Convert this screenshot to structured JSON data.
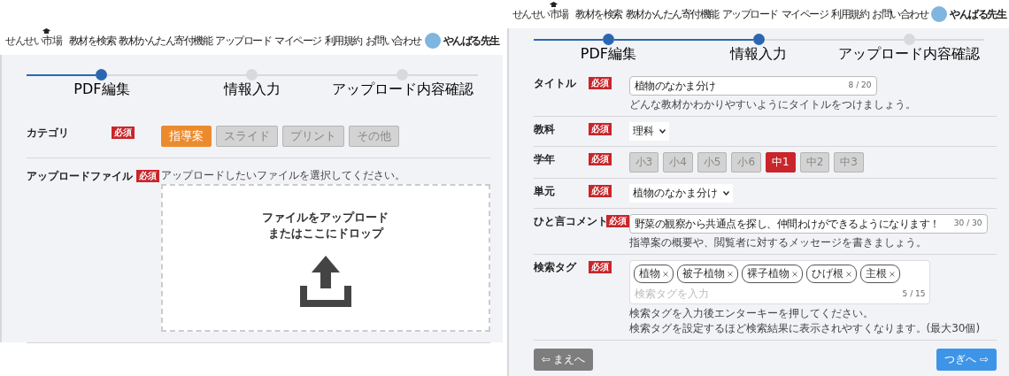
{
  "screens": [
    {
      "header": {
        "logo": "せんせい市場",
        "nav": [
          "教材を検索",
          "教材かんたん寄付機能",
          "アップロード",
          "マイページ",
          "利用規約",
          "お問い合わせ"
        ],
        "user": "やんばる先生"
      },
      "steps": [
        {
          "label": "PDF編集",
          "reached": true
        },
        {
          "label": "情報入力",
          "reached": false
        },
        {
          "label": "アップロード内容確認",
          "reached": false
        }
      ],
      "rows": [
        {
          "kind": "categories",
          "label": "カテゴリ",
          "badge": "必須",
          "options": [
            {
              "label": "指導案",
              "selected": true
            },
            {
              "label": "スライド",
              "selected": false
            },
            {
              "label": "プリント",
              "selected": false
            },
            {
              "label": "その他",
              "selected": false
            }
          ]
        },
        {
          "kind": "upload",
          "label": "アップロードファイル",
          "badge": "必須",
          "hint": "アップロードしたいファイルを選択してください。",
          "drop_lines": [
            "ファイルをアップロード",
            "またはここにドロップ"
          ]
        }
      ]
    },
    {
      "header": {
        "logo": "せんせい市場",
        "nav": [
          "教材を検索",
          "教材かんたん寄付機能",
          "アップロード",
          "マイページ",
          "利用規約",
          "お問い合わせ"
        ],
        "user": "やんばる先生"
      },
      "steps": [
        {
          "label": "PDF編集",
          "reached": true
        },
        {
          "label": "情報入力",
          "reached": true
        },
        {
          "label": "アップロード内容確認",
          "reached": false
        }
      ],
      "rows": [
        {
          "kind": "text",
          "label": "タイトル",
          "badge": "必須",
          "value": "植物のなかま分け",
          "counter": "8 / 20",
          "hints": [
            "どんな教材かわかりやすいようにタイトルをつけましょう。"
          ]
        },
        {
          "kind": "select",
          "label": "教科",
          "badge": "必須",
          "value": "理科"
        },
        {
          "kind": "grades",
          "label": "学年",
          "badge": "必須",
          "options": [
            {
              "label": "小3",
              "selected": false
            },
            {
              "label": "小4",
              "selected": false
            },
            {
              "label": "小5",
              "selected": false
            },
            {
              "label": "小6",
              "selected": false
            },
            {
              "label": "中1",
              "selected": true
            },
            {
              "label": "中2",
              "selected": false
            },
            {
              "label": "中3",
              "selected": false
            }
          ]
        },
        {
          "kind": "select",
          "label": "単元",
          "badge": "必須",
          "value": "植物のなかま分け"
        },
        {
          "kind": "text",
          "label": "ひと言コメント",
          "badge": "必須",
          "value": "野菜の観察から共通点を探し、仲間わけができるようになります！",
          "counter": "30 / 30",
          "hints": [
            "指導案の概要や、閲覧者に対するメッセージを書きましょう。"
          ]
        },
        {
          "kind": "tags",
          "label": "検索タグ",
          "badge": "必須",
          "tags": [
            "植物",
            "被子植物",
            "裸子植物",
            "ひげ根",
            "主根"
          ],
          "placeholder": "検索タグを入力",
          "counter": "5 / 15",
          "hints": [
            "検索タグを入力後エンターキーを押してください。",
            "検索タグを設定するほど検索結果に表示されやすくなります。(最大30個)"
          ]
        }
      ],
      "buttons": [
        {
          "kind": "back",
          "label": "⇦ まえへ"
        },
        {
          "kind": "next",
          "label": "つぎへ ⇨"
        }
      ]
    }
  ]
}
